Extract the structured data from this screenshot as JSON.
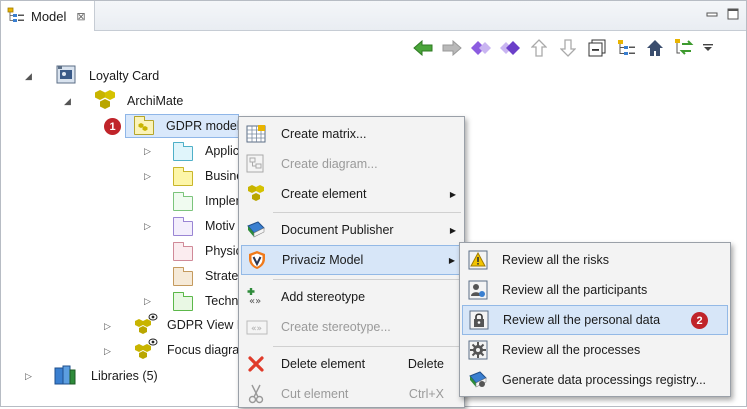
{
  "tab": {
    "title": "Model",
    "close_glyph": "⊠"
  },
  "toolbar": {
    "buttons": [
      "back-icon",
      "forward-icon",
      "link-left-icon",
      "link-right-icon",
      "up-icon",
      "down-icon",
      "collapse-all-icon",
      "view-menu-icon",
      "home-icon",
      "sync-icon"
    ]
  },
  "tree": {
    "items": [
      {
        "label": "Loyalty Card"
      },
      {
        "label": "ArchiMate"
      },
      {
        "label": "GDPR model"
      },
      {
        "label": "Applic"
      },
      {
        "label": "Busine"
      },
      {
        "label": "Implen"
      },
      {
        "label": "Motiv"
      },
      {
        "label": "Physic"
      },
      {
        "label": "Strate"
      },
      {
        "label": "Techn"
      },
      {
        "label": "GDPR View Po"
      },
      {
        "label": "Focus diagram"
      },
      {
        "label": "Libraries (5)"
      }
    ]
  },
  "context_menu": {
    "items": [
      {
        "label": "Create matrix...",
        "enabled": true,
        "submenu": false
      },
      {
        "label": "Create diagram...",
        "enabled": false,
        "submenu": false
      },
      {
        "label": "Create element",
        "enabled": true,
        "submenu": true
      },
      {
        "label": "Document Publisher",
        "enabled": true,
        "submenu": true
      },
      {
        "label": "Privaciz Model",
        "enabled": true,
        "submenu": true
      },
      {
        "label": "Add stereotype",
        "enabled": true,
        "submenu": false
      },
      {
        "label": "Create stereotype...",
        "enabled": false,
        "submenu": false
      },
      {
        "label": "Delete element",
        "enabled": true,
        "accelerator": "Delete"
      },
      {
        "label": "Cut element",
        "enabled": false,
        "accelerator": "Ctrl+X"
      }
    ]
  },
  "submenu": {
    "items": [
      {
        "label": "Review all the risks"
      },
      {
        "label": "Review all the participants"
      },
      {
        "label": "Review all the personal data"
      },
      {
        "label": "Review all the processes"
      },
      {
        "label": "Generate data processings registry..."
      }
    ]
  },
  "badges": {
    "first": "1",
    "second": "2"
  },
  "colors": {
    "accent": "#c0242a",
    "selection": "#d9e8fb",
    "archimate": "#c8b400",
    "green_arrow": "#3d9a2e",
    "purple": "#7a4fd1"
  }
}
